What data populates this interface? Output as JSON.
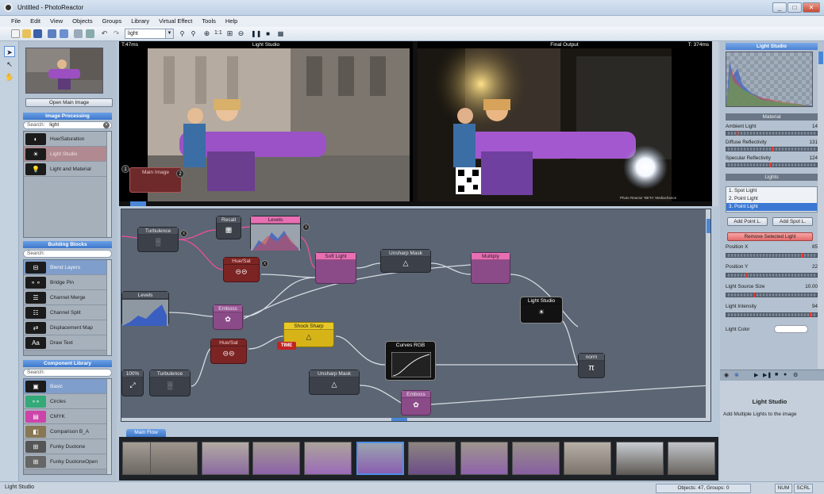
{
  "window": {
    "title": "Untitled - PhotoReactor",
    "min": "_",
    "max": "□",
    "close": "✕"
  },
  "menu": [
    "File",
    "Edit",
    "View",
    "Objects",
    "Groups",
    "Library",
    "Virtual Effect",
    "Tools",
    "Help"
  ],
  "toolbar": {
    "search_value": "light",
    "zoom_label": "1:1"
  },
  "left": {
    "open_main_image": "Open Main Image",
    "image_processing": {
      "header": "Image Processing",
      "search_label": "Search:",
      "search_value": "light",
      "items": [
        "Hue/Saturation",
        "Light Studio",
        "Light and Material"
      ]
    },
    "building_blocks": {
      "header": "Building Blocks",
      "search_label": "Search:",
      "items": [
        "Blend Layers",
        "Bridge Pin",
        "Channel Merge",
        "Channel Split",
        "Displacement Map",
        "Draw Text"
      ]
    },
    "component_library": {
      "header": "Component Library",
      "search_label": "Search:",
      "items": [
        "Basic",
        "Circles",
        "CMYK",
        "Comparison B_A",
        "Funky Duotone",
        "Funky DuotoneOpen"
      ]
    }
  },
  "preview_left": {
    "title": "Light Studio",
    "time": "T:47ms",
    "node_label": "Main Image",
    "badge1": "1",
    "badge2": "2"
  },
  "preview_right": {
    "title": "Final Output",
    "time": "T: 374ms",
    "watermark": "Photo Reactor 'BETA' Mediachance"
  },
  "graph": {
    "nodes": {
      "turbulence1": "Turbulence",
      "recall": "Recall",
      "levels1": "Levels",
      "huesat1": "Hue/Sat",
      "softlight": "Soft Light",
      "unsharp1": "Unsharp Mask",
      "multiply": "Multiply",
      "levels2": "Levels",
      "emboss1": "Emboss",
      "lightstudio": "Light Studio",
      "shocksharp": "Shock Sharp",
      "time": "TIME",
      "huesat2": "Hue/Sat",
      "curves": "Curves RGB",
      "norm": "norm",
      "zoom": "100%",
      "turbulence2": "Turbulence",
      "unsharp2": "Unsharp Mask",
      "emboss2": "Emboss"
    },
    "badges": {
      "b1": "X",
      "b2": "X",
      "b3": "X"
    }
  },
  "right": {
    "header": "Light Studio",
    "material_header": "Material",
    "sliders": [
      {
        "label": "Ambient Light",
        "value": "14",
        "pos": 0.12
      },
      {
        "label": "Diffuse Reflectivity",
        "value": "131",
        "pos": 0.51
      },
      {
        "label": "Specular Reflectivity",
        "value": "124",
        "pos": 0.49
      }
    ],
    "lights_header": "Lights",
    "lights": [
      "1. Spot Light",
      "2. Point Light",
      "3. Point Light"
    ],
    "add_point": "Add Point L.",
    "add_spot": "Add Spot L.",
    "remove": "Remove Selected Light",
    "params": [
      {
        "label": "Position X",
        "value": "85",
        "pos": 0.85
      },
      {
        "label": "Position Y",
        "value": "22",
        "pos": 0.22
      },
      {
        "label": "Light Source Size",
        "value": "10.00",
        "pos": 0.3
      },
      {
        "label": "Light Intensity",
        "value": "94",
        "pos": 0.94
      }
    ],
    "light_color_label": "Light Color",
    "info_title": "Light Studio",
    "info_desc": "Add Multiple Lights to the image"
  },
  "flow_tab": "Main Flow",
  "status": {
    "left": "Light Studio",
    "objects": "Objects: 47, Groups: 0",
    "num": "NUM",
    "scrl": "SCRL"
  }
}
